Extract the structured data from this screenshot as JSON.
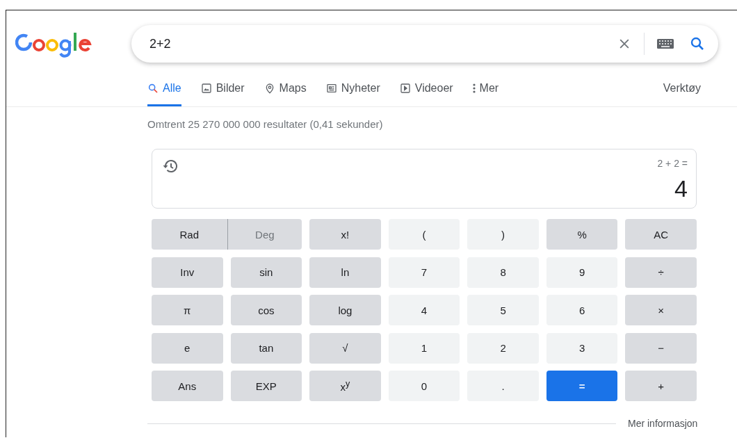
{
  "search": {
    "value": "2+2"
  },
  "tabs": [
    {
      "label": "Alle",
      "selected": true
    },
    {
      "label": "Bilder",
      "selected": false
    },
    {
      "label": "Maps",
      "selected": false
    },
    {
      "label": "Nyheter",
      "selected": false
    },
    {
      "label": "Videoer",
      "selected": false
    },
    {
      "label": "Mer",
      "selected": false
    }
  ],
  "tools": "Verktøy",
  "result_stats": "Omtrent 25 270 000 000 resultater (0,41 sekunder)",
  "calculator": {
    "expression": "2 + 2 =",
    "result": "4",
    "rows": [
      [
        {
          "kind": "angle",
          "label": "Rad",
          "selected": true
        },
        {
          "kind": "angle",
          "label": "Deg",
          "selected": false
        },
        {
          "kind": "func",
          "label": "x!"
        },
        {
          "kind": "num",
          "label": "("
        },
        {
          "kind": "num",
          "label": ")"
        },
        {
          "kind": "func",
          "label": "%"
        },
        {
          "kind": "func",
          "label": "AC"
        }
      ],
      [
        {
          "kind": "func",
          "label": "Inv"
        },
        {
          "kind": "func",
          "label": "sin"
        },
        {
          "kind": "func",
          "label": "ln"
        },
        {
          "kind": "num",
          "label": "7"
        },
        {
          "kind": "num",
          "label": "8"
        },
        {
          "kind": "num",
          "label": "9"
        },
        {
          "kind": "func",
          "label": "÷"
        }
      ],
      [
        {
          "kind": "func",
          "label": "π"
        },
        {
          "kind": "func",
          "label": "cos"
        },
        {
          "kind": "func",
          "label": "log"
        },
        {
          "kind": "num",
          "label": "4"
        },
        {
          "kind": "num",
          "label": "5"
        },
        {
          "kind": "num",
          "label": "6"
        },
        {
          "kind": "func",
          "label": "×"
        }
      ],
      [
        {
          "kind": "func",
          "label": "e"
        },
        {
          "kind": "func",
          "label": "tan"
        },
        {
          "kind": "func",
          "label": "√"
        },
        {
          "kind": "num",
          "label": "1"
        },
        {
          "kind": "num",
          "label": "2"
        },
        {
          "kind": "num",
          "label": "3"
        },
        {
          "kind": "func",
          "label": "−"
        }
      ],
      [
        {
          "kind": "func",
          "label": "Ans"
        },
        {
          "kind": "func",
          "label": "EXP"
        },
        {
          "kind": "func",
          "label": "x$^{y}$"
        },
        {
          "kind": "num",
          "label": "0"
        },
        {
          "kind": "num",
          "label": "."
        },
        {
          "kind": "equals",
          "label": "="
        },
        {
          "kind": "func",
          "label": "+"
        }
      ]
    ],
    "more_info": "Mer informasjon"
  }
}
